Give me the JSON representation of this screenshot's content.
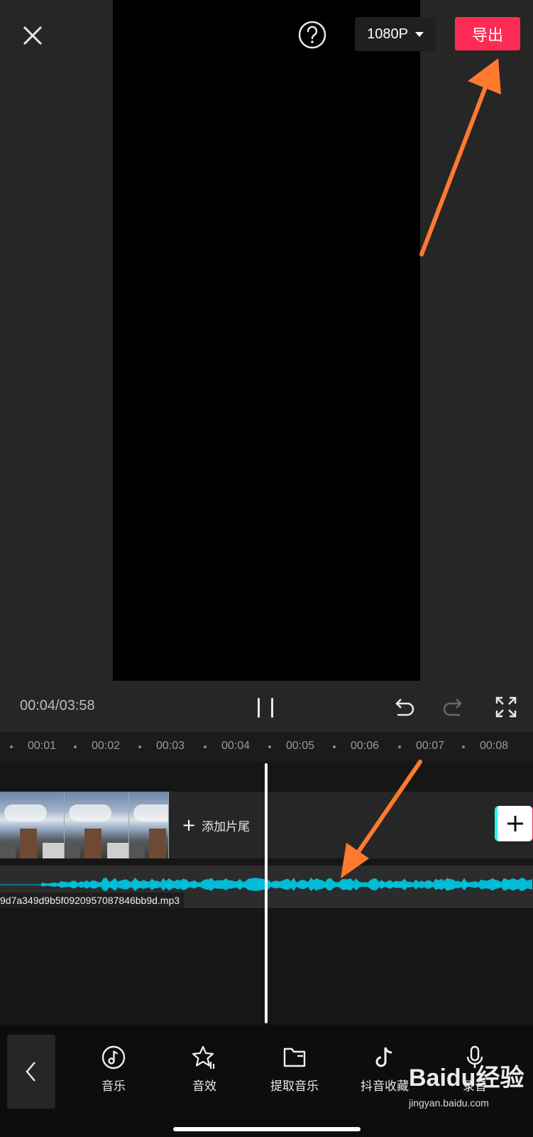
{
  "header": {
    "resolution": "1080P",
    "export_label": "导出"
  },
  "playback": {
    "timecode": "00:04/03:58"
  },
  "timeline": {
    "ruler_labels": [
      "00:01",
      "00:02",
      "00:03",
      "00:04",
      "00:05",
      "00:06",
      "00:07",
      "00:08"
    ],
    "add_ending_label": "添加片尾",
    "audio_filename": "9d7a349d9b5f0920957087846bb9d.mp3"
  },
  "toolbar": {
    "items": [
      {
        "label": "音乐",
        "icon": "music-note-icon"
      },
      {
        "label": "音效",
        "icon": "sound-effect-star-icon"
      },
      {
        "label": "提取音乐",
        "icon": "folder-icon"
      },
      {
        "label": "抖音收藏",
        "icon": "tiktok-icon"
      },
      {
        "label": "录音",
        "icon": "microphone-icon"
      }
    ]
  },
  "watermark": {
    "logo_text": "Baidu经验",
    "site": "jingyan.baidu.com"
  },
  "colors": {
    "accent": "#fe2c55",
    "waveform": "#00bcd4",
    "arrow": "#ff7a2f"
  }
}
